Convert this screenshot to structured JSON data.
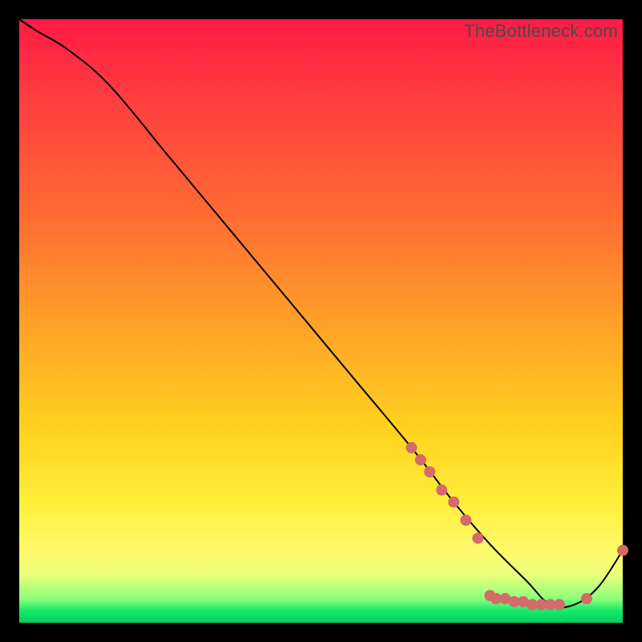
{
  "watermark": "TheBottleneck.com",
  "colors": {
    "background": "#000000",
    "line": "#000000",
    "marker_fill": "#d46a6a",
    "marker_stroke": "#d46a6a",
    "gradient_top": "#ff1a46",
    "gradient_bottom": "#00d060"
  },
  "chart_data": {
    "type": "line",
    "title": "",
    "xlabel": "",
    "ylabel": "",
    "xlim": [
      0,
      100
    ],
    "ylim": [
      0,
      100
    ],
    "grid": false,
    "legend": false,
    "series": [
      {
        "name": "curve",
        "x": [
          0,
          3,
          8,
          15,
          25,
          35,
          45,
          55,
          65,
          72,
          78,
          84,
          88,
          92,
          96,
          100
        ],
        "values": [
          100,
          98,
          95,
          89,
          77,
          65,
          53,
          41,
          29,
          20,
          13,
          7,
          3,
          3,
          6,
          12
        ]
      }
    ],
    "markers": [
      {
        "x": 65,
        "y": 29
      },
      {
        "x": 66.5,
        "y": 27
      },
      {
        "x": 68,
        "y": 25
      },
      {
        "x": 70,
        "y": 22
      },
      {
        "x": 72,
        "y": 20
      },
      {
        "x": 74,
        "y": 17
      },
      {
        "x": 76,
        "y": 14
      },
      {
        "x": 78,
        "y": 4.5
      },
      {
        "x": 79,
        "y": 4
      },
      {
        "x": 80.5,
        "y": 4
      },
      {
        "x": 82,
        "y": 3.5
      },
      {
        "x": 83.5,
        "y": 3.5
      },
      {
        "x": 85,
        "y": 3
      },
      {
        "x": 86.5,
        "y": 3
      },
      {
        "x": 88,
        "y": 3
      },
      {
        "x": 89.5,
        "y": 3
      },
      {
        "x": 94,
        "y": 4
      },
      {
        "x": 100,
        "y": 12
      }
    ]
  }
}
